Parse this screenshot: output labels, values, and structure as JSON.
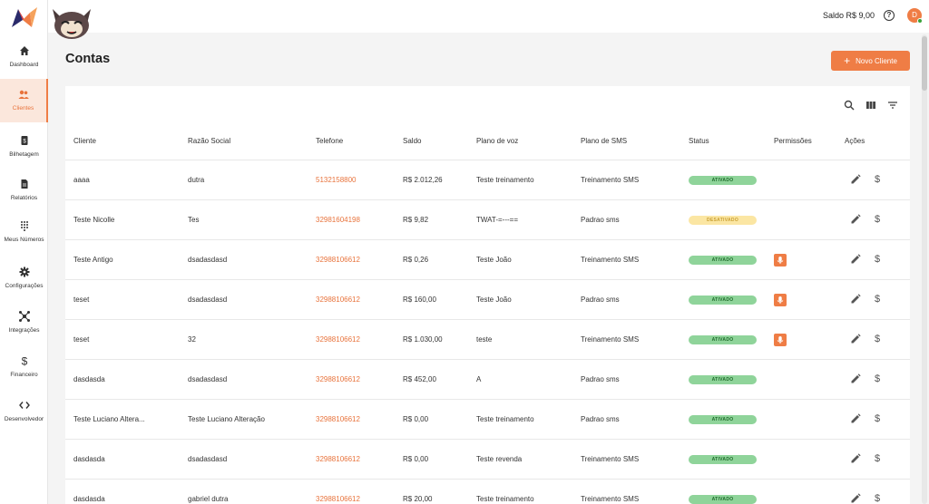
{
  "topbar": {
    "saldo": "Saldo R$ 9,00",
    "help": "?",
    "avatar_initial": "D"
  },
  "sidebar": {
    "items": [
      {
        "label": "Dashboard",
        "icon": "home-icon"
      },
      {
        "label": "Clientes",
        "icon": "users-icon",
        "active": true
      },
      {
        "label": "Bilhetagem",
        "icon": "receipt-icon"
      },
      {
        "label": "Relatórios",
        "icon": "document-icon"
      },
      {
        "label": "Meus Números",
        "icon": "dialpad-icon"
      },
      {
        "label": "Configurações",
        "icon": "gear-icon"
      },
      {
        "label": "Integrações",
        "icon": "hub-icon"
      },
      {
        "label": "Financeiro",
        "icon": "dollar-icon"
      },
      {
        "label": "Desenvolvedor",
        "icon": "code-icon"
      }
    ]
  },
  "page": {
    "title": "Contas",
    "new_button": "Novo Cliente"
  },
  "table": {
    "headers": [
      "Cliente",
      "Razão Social",
      "Telefone",
      "Saldo",
      "Plano de voz",
      "Plano de SMS",
      "Status",
      "Permissões",
      "Ações"
    ],
    "rows": [
      {
        "cliente": "aaaa",
        "razao": "dutra",
        "telefone": "5132158800",
        "saldo": "R$ 2.012,26",
        "voz": "Teste treinamento",
        "sms": "Treinamento SMS",
        "status": "ATIVADO",
        "status_type": "ativado",
        "perm": false
      },
      {
        "cliente": "Teste Nicolle",
        "razao": "Tes",
        "telefone": "32981604198",
        "saldo": "R$ 9,82",
        "voz": "TWAT-=---==",
        "sms": "Padrao sms",
        "status": "DESATIVADO",
        "status_type": "desativado",
        "perm": false
      },
      {
        "cliente": "Teste Antigo",
        "razao": "dsadasdasd",
        "telefone": "32988106612",
        "saldo": "R$ 0,26",
        "voz": "Teste João",
        "sms": "Treinamento SMS",
        "status": "ATIVADO",
        "status_type": "ativado",
        "perm": true
      },
      {
        "cliente": "teset",
        "razao": "dsadasdasd",
        "telefone": "32988106612",
        "saldo": "R$ 160,00",
        "voz": "Teste João",
        "sms": "Padrao sms",
        "status": "ATIVADO",
        "status_type": "ativado",
        "perm": true
      },
      {
        "cliente": "teset",
        "razao": "32",
        "telefone": "32988106612",
        "saldo": "R$ 1.030,00",
        "voz": "teste",
        "sms": "Treinamento SMS",
        "status": "ATIVADO",
        "status_type": "ativado",
        "perm": true
      },
      {
        "cliente": "dasdasda",
        "razao": "dsadasdasd",
        "telefone": "32988106612",
        "saldo": "R$ 452,00",
        "voz": "A",
        "sms": "Padrao sms",
        "status": "ATIVADO",
        "status_type": "ativado",
        "perm": false
      },
      {
        "cliente": "Teste Luciano Altera...",
        "razao": "Teste Luciano Alteração",
        "telefone": "32988106612",
        "saldo": "R$ 0,00",
        "voz": "Teste treinamento",
        "sms": "Padrao sms",
        "status": "ATIVADO",
        "status_type": "ativado",
        "perm": false
      },
      {
        "cliente": "dasdasda",
        "razao": "dsadasdasd",
        "telefone": "32988106612",
        "saldo": "R$ 0,00",
        "voz": "Teste revenda",
        "sms": "Treinamento SMS",
        "status": "ATIVADO",
        "status_type": "ativado",
        "perm": false
      },
      {
        "cliente": "dasdasda",
        "razao": "gabriel dutra",
        "telefone": "32988106612",
        "saldo": "R$ 20,00",
        "voz": "Teste treinamento",
        "sms": "Treinamento SMS",
        "status": "ATIVADO",
        "status_type": "ativado",
        "perm": false
      }
    ]
  },
  "colors": {
    "accent": "#ef7d45",
    "active_badge": "#8fd49a",
    "inactive_badge": "#fbe6a3"
  }
}
